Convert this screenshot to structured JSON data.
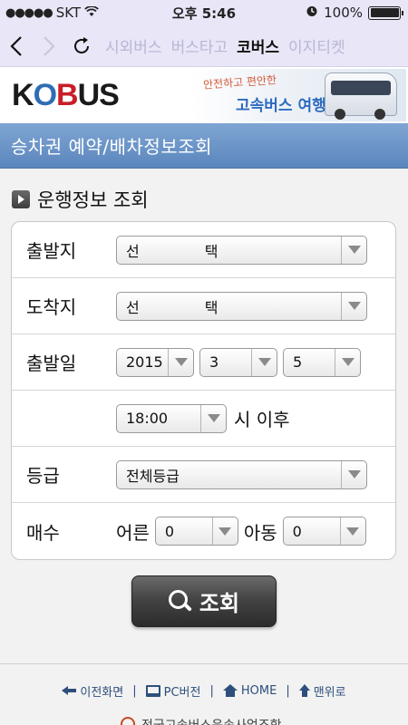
{
  "status_bar": {
    "carrier": "SKT",
    "time": "오후 5:46",
    "battery": "100%",
    "battery_level": 1.0
  },
  "nav": {
    "back_icon": "chevron-left-icon",
    "forward_icon": "chevron-right-icon",
    "reload_icon": "reload-icon",
    "tabs": [
      {
        "label": "시외버스",
        "active": false
      },
      {
        "label": "버스타고",
        "active": false
      },
      {
        "label": "코버스",
        "active": true
      },
      {
        "label": "이지티켓",
        "active": false
      }
    ]
  },
  "brand": {
    "logo": "KOBUS",
    "banner_line1": "안전하고 편안한",
    "banner_line2": "고속버스 여행"
  },
  "page_title": "승차권 예약/배차정보조회",
  "section_title": "운행정보 조회",
  "form": {
    "departure": {
      "label": "출발지",
      "value_a": "선",
      "value_b": "택"
    },
    "arrival": {
      "label": "도착지",
      "value_a": "선",
      "value_b": "택"
    },
    "date": {
      "label": "출발일",
      "year": "2015",
      "month": "3",
      "day": "5"
    },
    "time": {
      "value": "18:00",
      "suffix": "시 이후"
    },
    "grade": {
      "label": "등급",
      "value": "전체등급"
    },
    "count": {
      "label": "매수",
      "adult_label": "어른",
      "adult_value": "0",
      "child_label": "아동",
      "child_value": "0"
    }
  },
  "search_button": "조회",
  "footer": {
    "back": "이전화면",
    "pc": "PC버전",
    "home": "HOME",
    "top": "맨위로"
  },
  "bottom_text": "전국고속버스운송사업조합",
  "colors": {
    "title_bar": "#6f97c9",
    "nav_bg": "#e8e6f7",
    "footer_link": "#2d4f7c"
  }
}
